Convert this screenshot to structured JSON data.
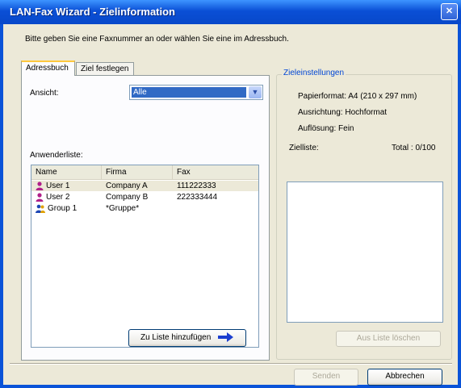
{
  "window": {
    "title": "LAN-Fax Wizard - Zielinformation"
  },
  "instruction": "Bitte geben Sie eine Faxnummer an oder wählen Sie eine im Adressbuch.",
  "tabs": [
    {
      "label": "Adressbuch",
      "active": true
    },
    {
      "label": "Ziel festlegen",
      "active": false
    }
  ],
  "adressbuch": {
    "ansicht_label": "Ansicht:",
    "ansicht_value": "Alle",
    "anwenderliste_label": "Anwenderliste:",
    "columns": [
      "Name",
      "Firma",
      "Fax"
    ],
    "rows": [
      {
        "name": "User 1",
        "firma": "Company A",
        "fax": "111222333",
        "icon": "user-icon",
        "selected": true
      },
      {
        "name": "User 2",
        "firma": "Company B",
        "fax": "222333444",
        "icon": "user-icon",
        "selected": false
      },
      {
        "name": "Group 1",
        "firma": "*Gruppe*",
        "fax": "",
        "icon": "group-icon",
        "selected": false
      }
    ],
    "add_button": "Zu Liste hinzufügen"
  },
  "zieleinstellungen": {
    "legend": "Zieleinstellungen",
    "papier": "Papierformat: A4 (210 x 297 mm)",
    "ausrichtung": "Ausrichtung: Hochformat",
    "aufloesung": "Auflösung: Fein",
    "zielliste_label": "Zielliste:",
    "total": "Total : 0/100",
    "remove_button": "Aus Liste löschen"
  },
  "footer": {
    "send_button": "Senden",
    "cancel_button": "Abbrechen"
  },
  "colors": {
    "titlebar": "#0a4fd6",
    "selection": "#316ac5",
    "arrow": "#1c3fd0",
    "user_icon": "#b0208a",
    "group_icon": "#1e46b4"
  }
}
